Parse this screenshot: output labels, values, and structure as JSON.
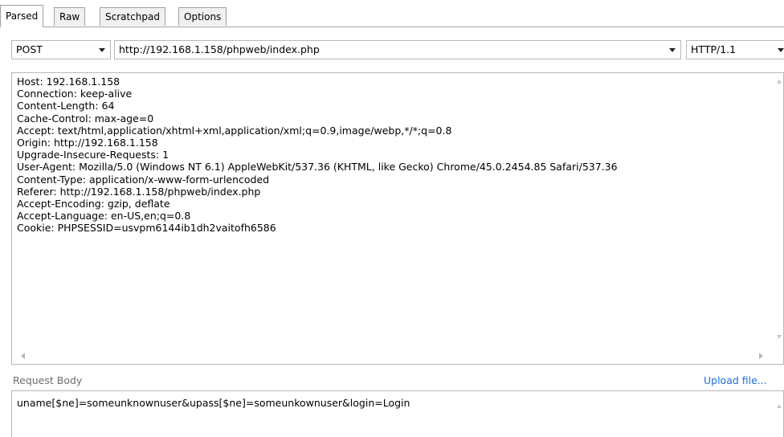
{
  "tabs": [
    {
      "label": "Parsed",
      "active": true
    },
    {
      "label": "Raw",
      "active": false
    },
    {
      "label": "Scratchpad",
      "active": false
    },
    {
      "label": "Options",
      "active": false
    }
  ],
  "request_line": {
    "method": "POST",
    "url": "http://192.168.1.158/phpweb/index.php",
    "protocol": "HTTP/1.1"
  },
  "headers": [
    "Host: 192.168.1.158",
    "Connection: keep-alive",
    "Content-Length: 64",
    "Cache-Control: max-age=0",
    "Accept: text/html,application/xhtml+xml,application/xml;q=0.9,image/webp,*/*;q=0.8",
    "Origin: http://192.168.1.158",
    "Upgrade-Insecure-Requests: 1",
    "User-Agent: Mozilla/5.0 (Windows NT 6.1) AppleWebKit/537.36 (KHTML, like Gecko) Chrome/45.0.2454.85 Safari/537.36",
    "Content-Type: application/x-www-form-urlencoded",
    "Referer: http://192.168.1.158/phpweb/index.php",
    "Accept-Encoding: gzip, deflate",
    "Accept-Language: en-US,en;q=0.8",
    "Cookie: PHPSESSID=usvpm6144ib1dh2vaitofh6586"
  ],
  "request_body": {
    "label": "Request Body",
    "upload_link": "Upload file...",
    "content": "uname[$ne]=someunknownuser&upass[$ne]=someunkownuser&login=Login"
  }
}
